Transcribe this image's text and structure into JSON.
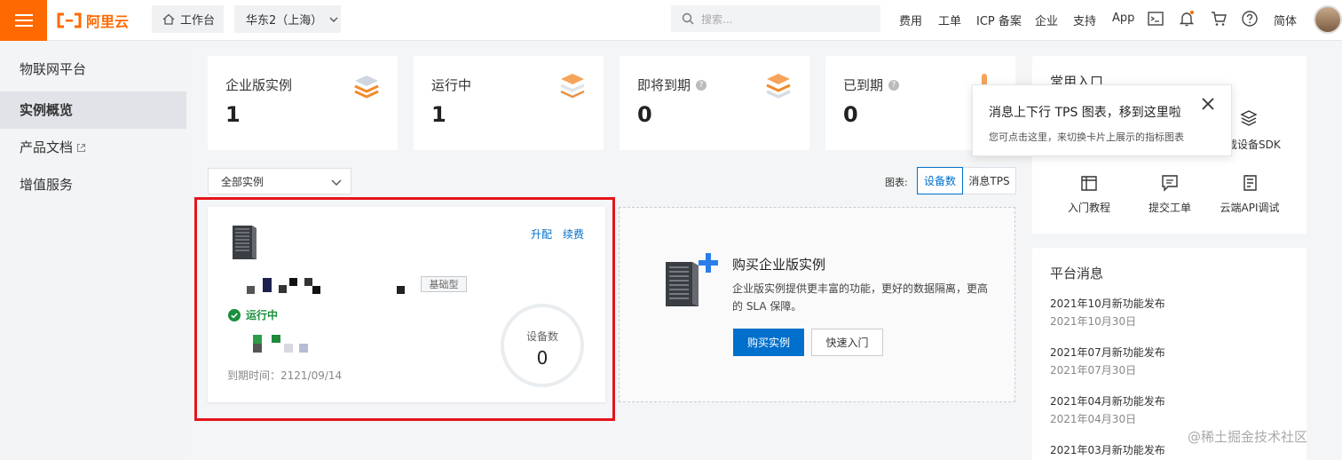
{
  "header": {
    "logo_text": "阿里云",
    "workbench_label": "工作台",
    "region_label": "华东2（上海）",
    "search_placeholder": "搜索...",
    "nav": [
      "费用",
      "工单",
      "ICP 备案",
      "企业",
      "支持",
      "App"
    ],
    "language_label": "简体"
  },
  "sidebar": {
    "title": "物联网平台",
    "items": [
      {
        "label": "实例概览",
        "active": true
      },
      {
        "label": "产品文档",
        "external": true
      },
      {
        "label": "增值服务"
      }
    ]
  },
  "stats": [
    {
      "label": "企业版实例",
      "value": "1"
    },
    {
      "label": "运行中",
      "value": "1"
    },
    {
      "label": "即将到期",
      "value": "0",
      "help": true
    },
    {
      "label": "已到期",
      "value": "0",
      "help": true
    }
  ],
  "popover": {
    "title": "消息上下行 TPS 图表，移到这里啦",
    "description": "您可点击这里，来切换卡片上展示的指标图表"
  },
  "filter": {
    "instance_filter": "全部实例",
    "chart_label": "图表:",
    "toggles": [
      "设备数",
      "消息TPS"
    ],
    "active_toggle": "设备数"
  },
  "instance": {
    "upgrade_label": "升配",
    "renew_label": "续费",
    "type_badge": "基础型",
    "status": "运行中",
    "expire_label": "到期时间：2121/09/14",
    "gauge_label": "设备数",
    "gauge_value": "0"
  },
  "buy": {
    "title": "购买企业版实例",
    "description": "企业版实例提供更丰富的功能，更好的数据隔离，更高的 SLA 保障。",
    "buy_button": "购买实例",
    "quick_button": "快速入门"
  },
  "common_entries": {
    "title": "常用入口",
    "partial_label": "载设备SDK",
    "items": [
      "入门教程",
      "提交工单",
      "云端API调试"
    ]
  },
  "platform_news": {
    "title": "平台消息",
    "items": [
      {
        "title": "2021年10月新功能发布",
        "date": "2021年10月30日"
      },
      {
        "title": "2021年07月新功能发布",
        "date": "2021年07月30日"
      },
      {
        "title": "2021年04月新功能发布",
        "date": "2021年04月30日"
      },
      {
        "title": "2021年03月新功能发布"
      }
    ]
  },
  "watermark": "@稀土掘金技术社区",
  "colors": {
    "brand_orange": "#ff6a00",
    "link_blue": "#0070cc",
    "status_green": "#1a8f3c",
    "highlight_red": "#e4151c"
  }
}
